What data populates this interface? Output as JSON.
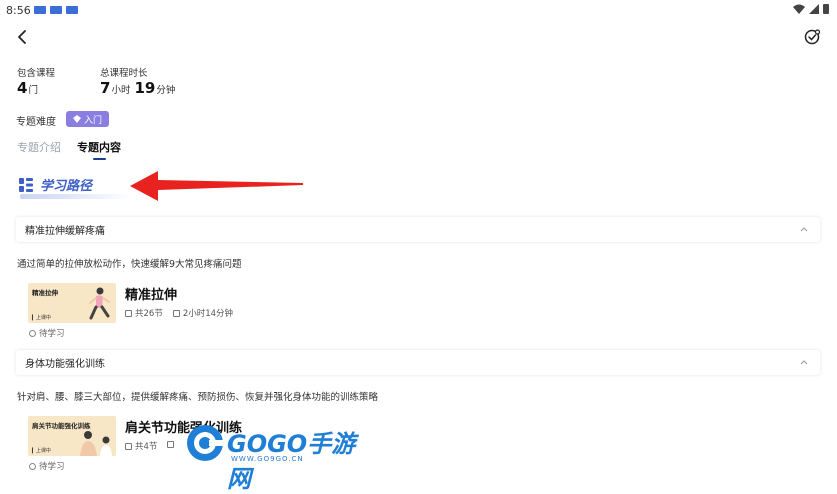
{
  "status_bar": {
    "time": "8:56"
  },
  "stats": {
    "course_count_label": "包含课程",
    "course_count_value": "4",
    "course_count_unit": "门",
    "duration_label": "总课程时长",
    "duration_hours": "7",
    "duration_hours_unit": "小时",
    "duration_minutes": "19",
    "duration_minutes_unit": "分钟"
  },
  "difficulty": {
    "label": "专题难度",
    "badge": "入门"
  },
  "tabs": [
    {
      "label": "专题介绍",
      "active": false
    },
    {
      "label": "专题内容",
      "active": true
    }
  ],
  "path": {
    "title": "学习路径"
  },
  "sections": [
    {
      "title": "精准拉伸缓解疼痛",
      "description": "通过简单的拉伸放松动作，快速缓解9大常见疼痛问题",
      "course": {
        "thumb_title": "精准拉伸",
        "thumb_tag": "▎上课中",
        "title": "精准拉伸",
        "lessons": "共26节",
        "duration": "2小时14分钟",
        "status": "待学习"
      }
    },
    {
      "title": "身体功能强化训练",
      "description": "针对肩、腰、膝三大部位，提供缓解疼痛、预防损伤、恢复并强化身体功能的训练策略",
      "course": {
        "thumb_title": "肩关节功能强化训练",
        "thumb_tag": "▎上课中",
        "title": "肩关节功能强化训练",
        "lessons": "共4节",
        "duration": "",
        "status": "待学习"
      }
    }
  ],
  "watermark": {
    "brand": "GOGO手游网",
    "url": "WWW.GO9GO.CN"
  },
  "colors": {
    "accent": "#3d5fc7",
    "badge": "#8a7fe0",
    "arrow": "#e8231f",
    "thumb_bg": "#f8e7c6"
  }
}
